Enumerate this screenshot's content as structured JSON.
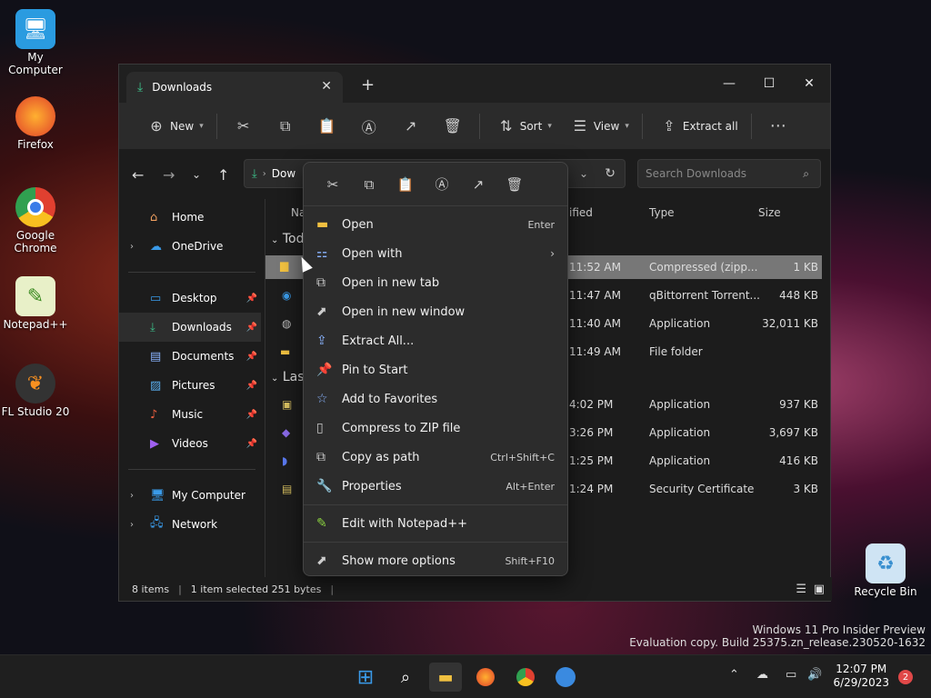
{
  "desktop": {
    "icons": [
      {
        "label": "My Computer",
        "icon": "monitor-icon"
      },
      {
        "label": "Firefox",
        "icon": "firefox-icon"
      },
      {
        "label": "Google Chrome",
        "icon": "chrome-icon"
      },
      {
        "label": "Notepad++",
        "icon": "notepad-icon"
      },
      {
        "label": "FL Studio 20",
        "icon": "flstudio-icon"
      },
      {
        "label": "Recycle Bin",
        "icon": "recycle-bin-icon"
      }
    ]
  },
  "window": {
    "tab_title": "Downloads",
    "toolbar": {
      "new": "New",
      "sort": "Sort",
      "view": "View",
      "extract_all": "Extract all"
    },
    "address_partial": "Dow",
    "search_placeholder": "Search Downloads",
    "sidebar": {
      "home": "Home",
      "onedrive": "OneDrive",
      "desktop": "Desktop",
      "downloads": "Downloads",
      "documents": "Documents",
      "pictures": "Pictures",
      "music": "Music",
      "videos": "Videos",
      "my_computer": "My Computer",
      "network": "Network"
    },
    "columns": {
      "name": "Na",
      "modified": "ified",
      "type": "Type",
      "size": "Size"
    },
    "groups": {
      "today": "Tod",
      "last": "Las"
    },
    "rows": [
      {
        "time": "11:52 AM",
        "type": "Compressed (zipp...",
        "size": "1 KB"
      },
      {
        "time": "11:47 AM",
        "type": "qBittorrent Torrent...",
        "size": "448 KB"
      },
      {
        "time": "11:40 AM",
        "type": "Application",
        "size": "32,011 KB"
      },
      {
        "time": "11:49 AM",
        "type": "File folder",
        "size": ""
      },
      {
        "time": "4:02 PM",
        "type": "Application",
        "size": "937 KB"
      },
      {
        "time": "3:26 PM",
        "type": "Application",
        "size": "3,697 KB"
      },
      {
        "time": "1:25 PM",
        "type": "Application",
        "size": "416 KB"
      },
      {
        "time": "1:24 PM",
        "type": "Security Certificate",
        "size": "3 KB"
      }
    ],
    "status": {
      "items": "8 items",
      "selected": "1 item selected  251 bytes"
    }
  },
  "context_menu": {
    "items": [
      {
        "label": "Open",
        "shortcut": "Enter"
      },
      {
        "label": "Open with",
        "shortcut": ""
      },
      {
        "label": "Open in new tab",
        "shortcut": ""
      },
      {
        "label": "Open in new window",
        "shortcut": ""
      },
      {
        "label": "Extract All...",
        "shortcut": ""
      },
      {
        "label": "Pin to Start",
        "shortcut": ""
      },
      {
        "label": "Add to Favorites",
        "shortcut": ""
      },
      {
        "label": "Compress to ZIP file",
        "shortcut": ""
      },
      {
        "label": "Copy as path",
        "shortcut": "Ctrl+Shift+C"
      },
      {
        "label": "Properties",
        "shortcut": "Alt+Enter"
      },
      {
        "label": "Edit with Notepad++",
        "shortcut": ""
      },
      {
        "label": "Show more options",
        "shortcut": "Shift+F10"
      }
    ]
  },
  "watermark": {
    "line1": "Windows 11 Pro Insider Preview",
    "line2": "Evaluation copy. Build 25375.zn_release.230520-1632"
  },
  "taskbar": {
    "time": "12:07 PM",
    "date": "6/29/2023",
    "notifications": "2"
  }
}
